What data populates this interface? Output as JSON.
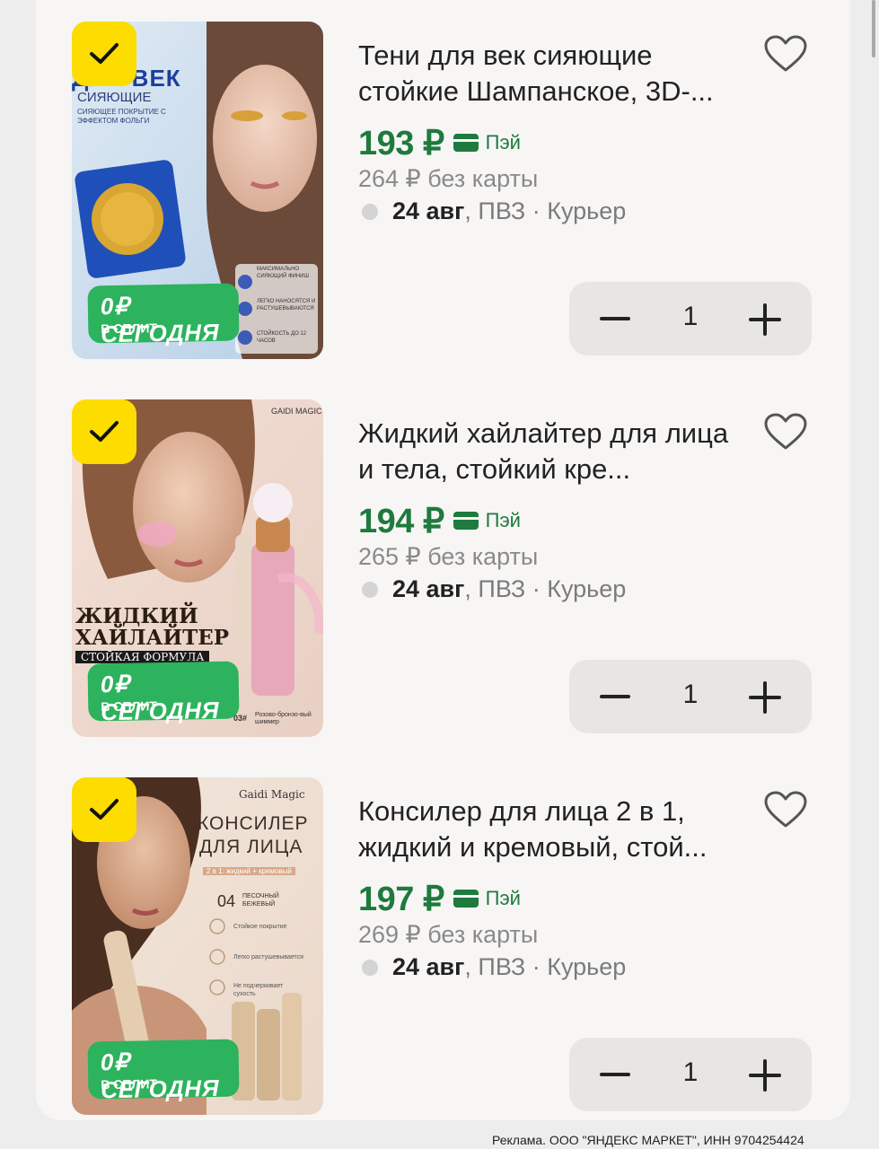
{
  "products": [
    {
      "title": "Тени для век сияющие стойкие Шампанское, 3D-...",
      "price": "193 ₽",
      "pay_label": "Пэй",
      "old_price": "264 ₽ без карты",
      "delivery_date": "24 авг",
      "delivery_rest": ", ПВЗ · Курьер",
      "quantity": "1",
      "split_big": "0₽ СЕГОДНЯ",
      "split_small": "В СПЛИТ",
      "image_text": [
        "ДЛЯ ВЕК",
        "СИЯЮЩИЕ",
        "СИЯЮЩЕЕ ПОКРЫТИЕ С ЭФФЕКТОМ ФОЛЬГИ",
        "МАКСИМАЛЬНО СИЯЮЩИЙ ФИНИШ",
        "ЛЕГКО НАНОСЯТСЯ И РАСТУШЕВЫВАЮТСЯ",
        "СТОЙКОСТЬ ДО 12 ЧАСОВ"
      ]
    },
    {
      "title": "Жидкий хайлайтер для лица и тела, стойкий кре...",
      "price": "194 ₽",
      "pay_label": "Пэй",
      "old_price": "265 ₽ без карты",
      "delivery_date": "24 авг",
      "delivery_rest": ", ПВЗ · Курьер",
      "quantity": "1",
      "split_big": "0₽ СЕГОДНЯ",
      "split_small": "В СПЛИТ",
      "image_text": [
        "GAIDI MAGIC",
        "ЖИДКИЙ",
        "ХАЙЛАЙТЕР",
        "СТОЙКАЯ ФОРМУЛА",
        "03#",
        "Розово-бронзо-вый шиммер"
      ]
    },
    {
      "title": "Консилер для лица 2 в 1, жидкий и кремовый, стой...",
      "price": "197 ₽",
      "pay_label": "Пэй",
      "old_price": "269 ₽ без карты",
      "delivery_date": "24 авг",
      "delivery_rest": ", ПВЗ · Курьер",
      "quantity": "1",
      "split_big": "0₽ СЕГОДНЯ",
      "split_small": "В СПЛИТ",
      "image_text": [
        "Gaidi Magic",
        "КОНСИЛЕР",
        "ДЛЯ ЛИЦА",
        "2 в 1: жидкий + кремовый",
        "04",
        "ПЕСОЧНЫЙ БЕЖЕВЫЙ",
        "Стойкое покрытие",
        "Легко растушевывается",
        "Не подчеркивает сухость"
      ]
    }
  ],
  "ad_notice": "Реклама. ООО \"ЯНДЕКС МАРКЕТ\", ИНН 9704254424",
  "colors": {
    "price_green": "#1e7a3d",
    "split_green": "#2db25d",
    "check_yellow": "#fddc00",
    "stepper_bg": "#e8e6e3"
  },
  "icons": [
    "check-icon",
    "heart-icon",
    "card-icon",
    "minus-icon",
    "plus-icon"
  ]
}
